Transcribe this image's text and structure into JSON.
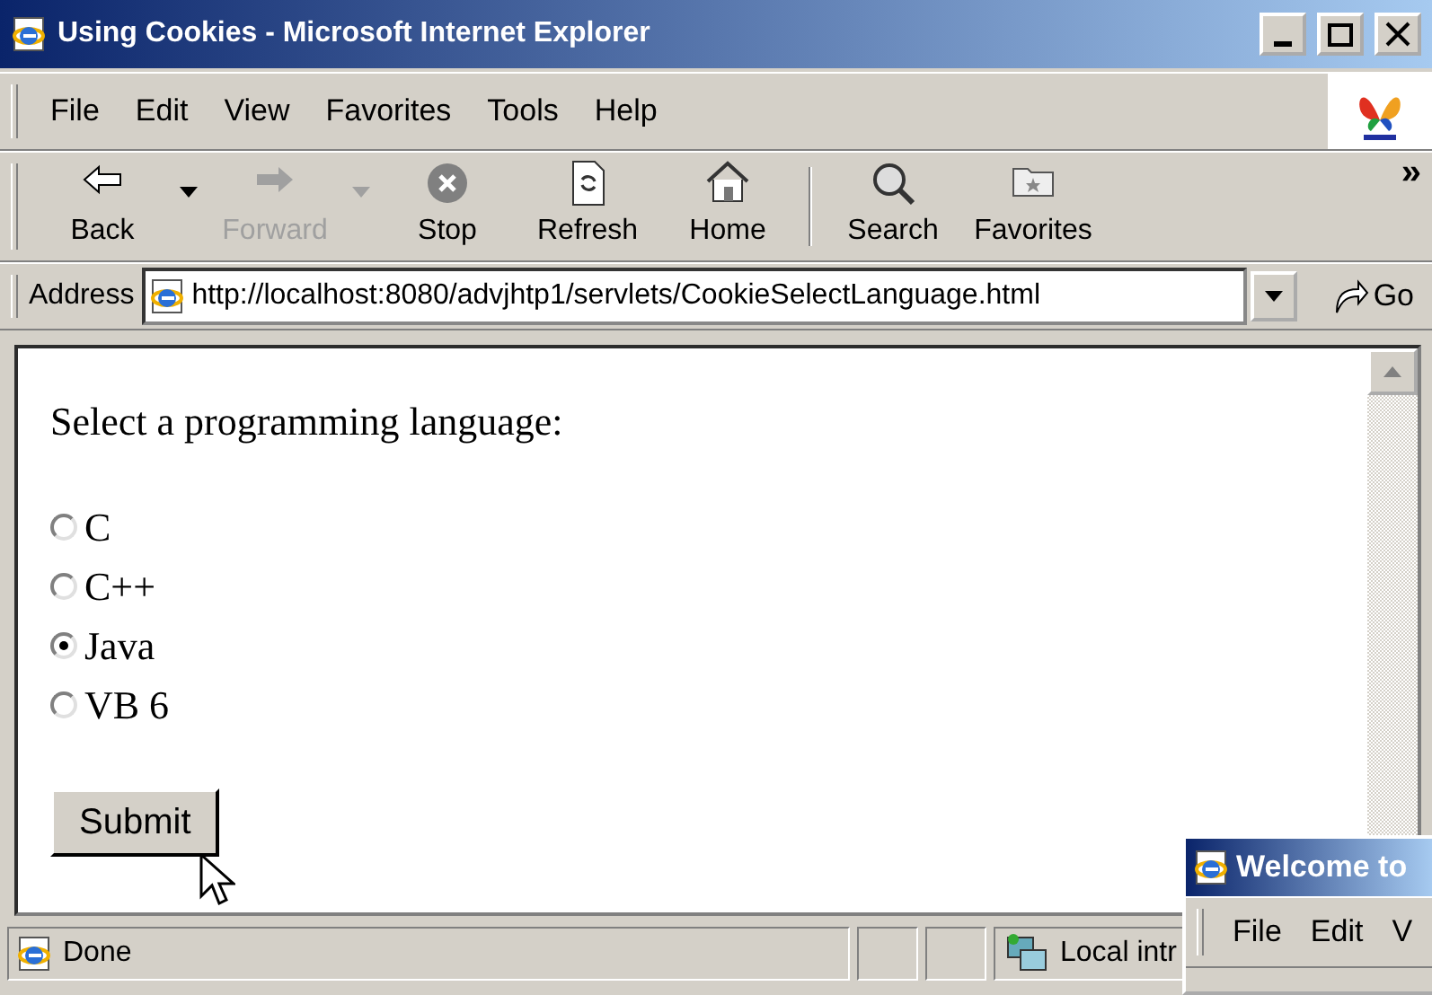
{
  "window": {
    "title": "Using Cookies - Microsoft Internet Explorer"
  },
  "menu": [
    "File",
    "Edit",
    "View",
    "Favorites",
    "Tools",
    "Help"
  ],
  "toolbar": [
    {
      "label": "Back",
      "kind": "back",
      "disabled": false,
      "dropdown": true,
      "separator_before": false
    },
    {
      "label": "Forward",
      "kind": "forward",
      "disabled": true,
      "dropdown": true,
      "separator_before": false
    },
    {
      "label": "Stop",
      "kind": "stop",
      "disabled": false,
      "dropdown": false,
      "separator_before": false
    },
    {
      "label": "Refresh",
      "kind": "refresh",
      "disabled": false,
      "dropdown": false,
      "separator_before": false
    },
    {
      "label": "Home",
      "kind": "home",
      "disabled": false,
      "dropdown": false,
      "separator_before": false
    },
    {
      "label": "Search",
      "kind": "search",
      "disabled": false,
      "dropdown": false,
      "separator_before": true
    },
    {
      "label": "Favorites",
      "kind": "favorites",
      "disabled": false,
      "dropdown": false,
      "separator_before": false
    }
  ],
  "toolbar_more": "»",
  "address": {
    "label": "Address",
    "url": "http://localhost:8080/advjhtp1/servlets/CookieSelectLanguage.html",
    "go": "Go"
  },
  "page": {
    "prompt": "Select a programming language:",
    "options": [
      {
        "label": "C",
        "selected": false
      },
      {
        "label": "C++",
        "selected": false
      },
      {
        "label": "Java",
        "selected": true
      },
      {
        "label": "VB 6",
        "selected": false
      }
    ],
    "submit": "Submit"
  },
  "status_bar": {
    "text": "Done",
    "zone": "Local intr"
  },
  "second_window": {
    "title": "Welcome to",
    "menu": [
      "File",
      "Edit",
      "V"
    ]
  }
}
